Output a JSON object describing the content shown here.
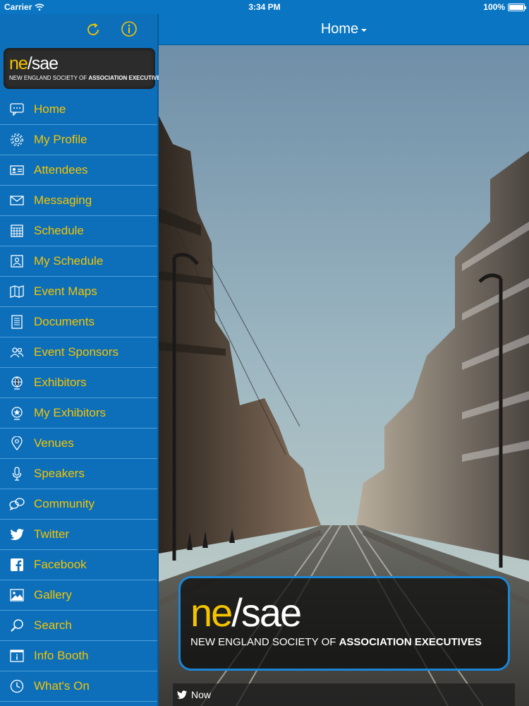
{
  "status": {
    "carrier": "Carrier",
    "time": "3:34 PM",
    "battery": "100%"
  },
  "sidebar": {
    "logo": {
      "ne": "ne",
      "sae": "/sae",
      "tagline_a": "NEW ENGLAND SOCIETY OF ",
      "tagline_b": "ASSOCIATION EXECUTIVES"
    },
    "items": [
      {
        "label": "Home",
        "icon": "home-chat-icon"
      },
      {
        "label": "My Profile",
        "icon": "gear-icon"
      },
      {
        "label": "Attendees",
        "icon": "id-card-icon"
      },
      {
        "label": "Messaging",
        "icon": "envelope-icon"
      },
      {
        "label": "Schedule",
        "icon": "calendar-icon"
      },
      {
        "label": "My Schedule",
        "icon": "user-calendar-icon"
      },
      {
        "label": "Event Maps",
        "icon": "map-icon"
      },
      {
        "label": "Documents",
        "icon": "document-icon"
      },
      {
        "label": "Event Sponsors",
        "icon": "people-icon"
      },
      {
        "label": "Exhibitors",
        "icon": "globe-icon"
      },
      {
        "label": "My Exhibitors",
        "icon": "star-globe-icon"
      },
      {
        "label": "Venues",
        "icon": "map-pin-icon"
      },
      {
        "label": "Speakers",
        "icon": "microphone-icon"
      },
      {
        "label": "Community",
        "icon": "chat-bubbles-icon"
      },
      {
        "label": "Twitter",
        "icon": "twitter-icon"
      },
      {
        "label": "Facebook",
        "icon": "facebook-icon"
      },
      {
        "label": "Gallery",
        "icon": "image-icon"
      },
      {
        "label": "Search",
        "icon": "search-icon"
      },
      {
        "label": "Info Booth",
        "icon": "info-booth-icon"
      },
      {
        "label": "What's On",
        "icon": "clock-icon"
      }
    ]
  },
  "header": {
    "title": "Home"
  },
  "main": {
    "logo": {
      "ne": "ne",
      "sae": "/sae",
      "tagline_a": "NEW ENGLAND SOCIETY OF ",
      "tagline_b": "ASSOCIATION EXECUTIVES"
    },
    "tweet": {
      "label": "Now"
    }
  },
  "colors": {
    "bar": "#0a76c3",
    "sidebar": "#0d6fba",
    "accent": "#f4c400",
    "divider": "#4f9fd8"
  }
}
